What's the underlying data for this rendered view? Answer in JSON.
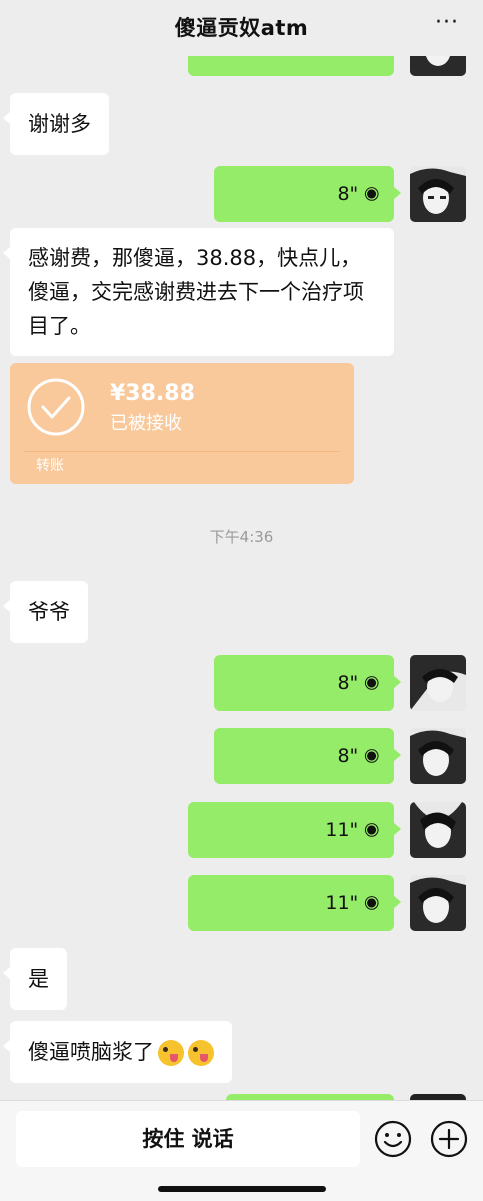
{
  "header": {
    "title": "傻逼贡奴atm",
    "more": "···"
  },
  "messages": {
    "m1": "谢谢多",
    "v1": "8\"",
    "m2": "感谢费，那傻逼，38.88，快点儿，傻逼，交完感谢费进去下一个治疗项目了。",
    "timestamp": "下午4:36",
    "m3": "爷爷",
    "v2": "8\"",
    "v3": "8\"",
    "v4": "11\"",
    "v5": "11\"",
    "m4": "是",
    "m5": "傻逼喷脑浆了"
  },
  "transfer": {
    "amount": "¥38.88",
    "status": "已被接收",
    "type": "转账"
  },
  "emoji": [
    "zany-face",
    "zany-face"
  ],
  "input_bar": {
    "hold_to_talk": "按住 说话",
    "emoji_icon": "smiley-icon",
    "plus_icon": "plus-icon"
  },
  "colors": {
    "background": "#ededed",
    "outgoing_bubble": "#95ec69",
    "incoming_bubble": "#ffffff",
    "transfer_card": "#f9c89b"
  }
}
